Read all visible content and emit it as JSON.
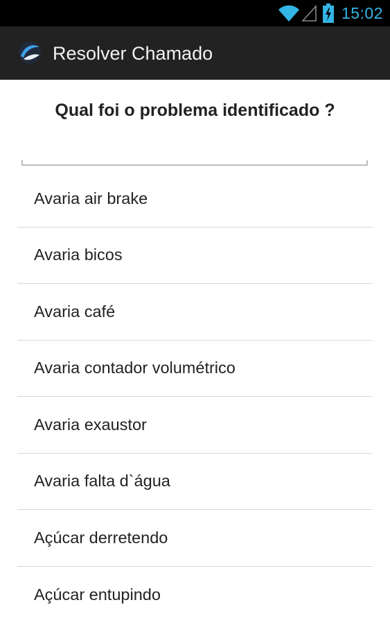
{
  "status_bar": {
    "time": "15:02",
    "icons": [
      "wifi-icon",
      "signal-icon",
      "battery-charging-icon"
    ],
    "clock_color": "#33b5e5"
  },
  "action_bar": {
    "title": "Resolver Chamado",
    "logo": "app-logo-icon",
    "background": "#222222"
  },
  "main": {
    "question": "Qual foi o problema identificado ?",
    "search": {
      "value": "",
      "placeholder": ""
    },
    "options": [
      {
        "label": "Avaria air brake"
      },
      {
        "label": "Avaria bicos"
      },
      {
        "label": "Avaria café"
      },
      {
        "label": "Avaria contador volumétrico"
      },
      {
        "label": "Avaria exaustor"
      },
      {
        "label": "Avaria falta d`água"
      },
      {
        "label": "Açúcar derretendo"
      },
      {
        "label": "Açúcar entupindo"
      }
    ]
  }
}
